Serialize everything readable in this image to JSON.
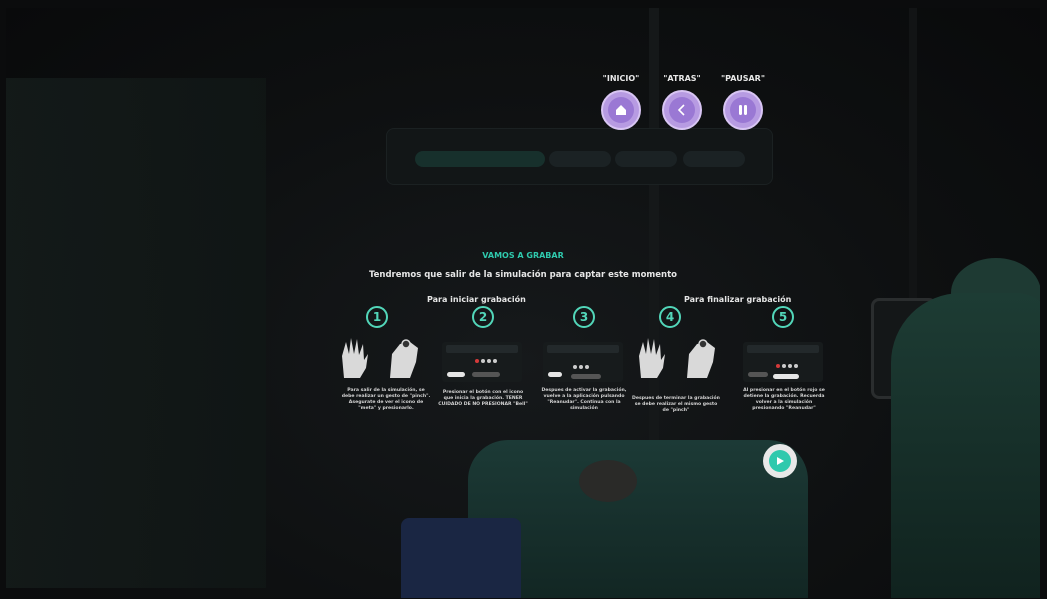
{
  "top_controls": {
    "home_label": "\"INICIO\"",
    "back_label": "\"ATRAS\"",
    "pause_label": "\"PAUSAR\""
  },
  "instructions": {
    "heading": "VAMOS A GRABAR",
    "subtitle": "Tendremos que salir de la simulación para captar este momento",
    "start_section": "Para iniciar grabación",
    "end_section": "Para finalizar grabación",
    "steps": [
      {
        "number": "1",
        "caption": "Para salir de la simulación, se debe realizar un gesto de \"pinch\". Asegurate de ver el icono de \"meta\" y presionarlo."
      },
      {
        "number": "2",
        "caption": "Presionar el botón con el icono que inicia la grabación. TENER CUIDADO DE NO PRESIONAR \"Bell\""
      },
      {
        "number": "3",
        "caption": "Despues de activar la grabación, vuelve a la aplicación pulsando \"Reanudar\". Continua con la simulación"
      },
      {
        "number": "4",
        "caption": "Despues de terminar la grabación se debe realizar el mismo gesto de \"pinch\""
      },
      {
        "number": "5",
        "caption": "Al presionar en el botón rojo se detiene la grabación. Recuerda volver a la simulación presionando \"Reanudar\""
      }
    ]
  },
  "colors": {
    "accent": "#2fc9ad",
    "button_purple": "#b79be2"
  },
  "icons": {
    "home": "home-icon",
    "back": "chevron-left-icon",
    "pause": "pause-icon",
    "play": "play-icon"
  }
}
